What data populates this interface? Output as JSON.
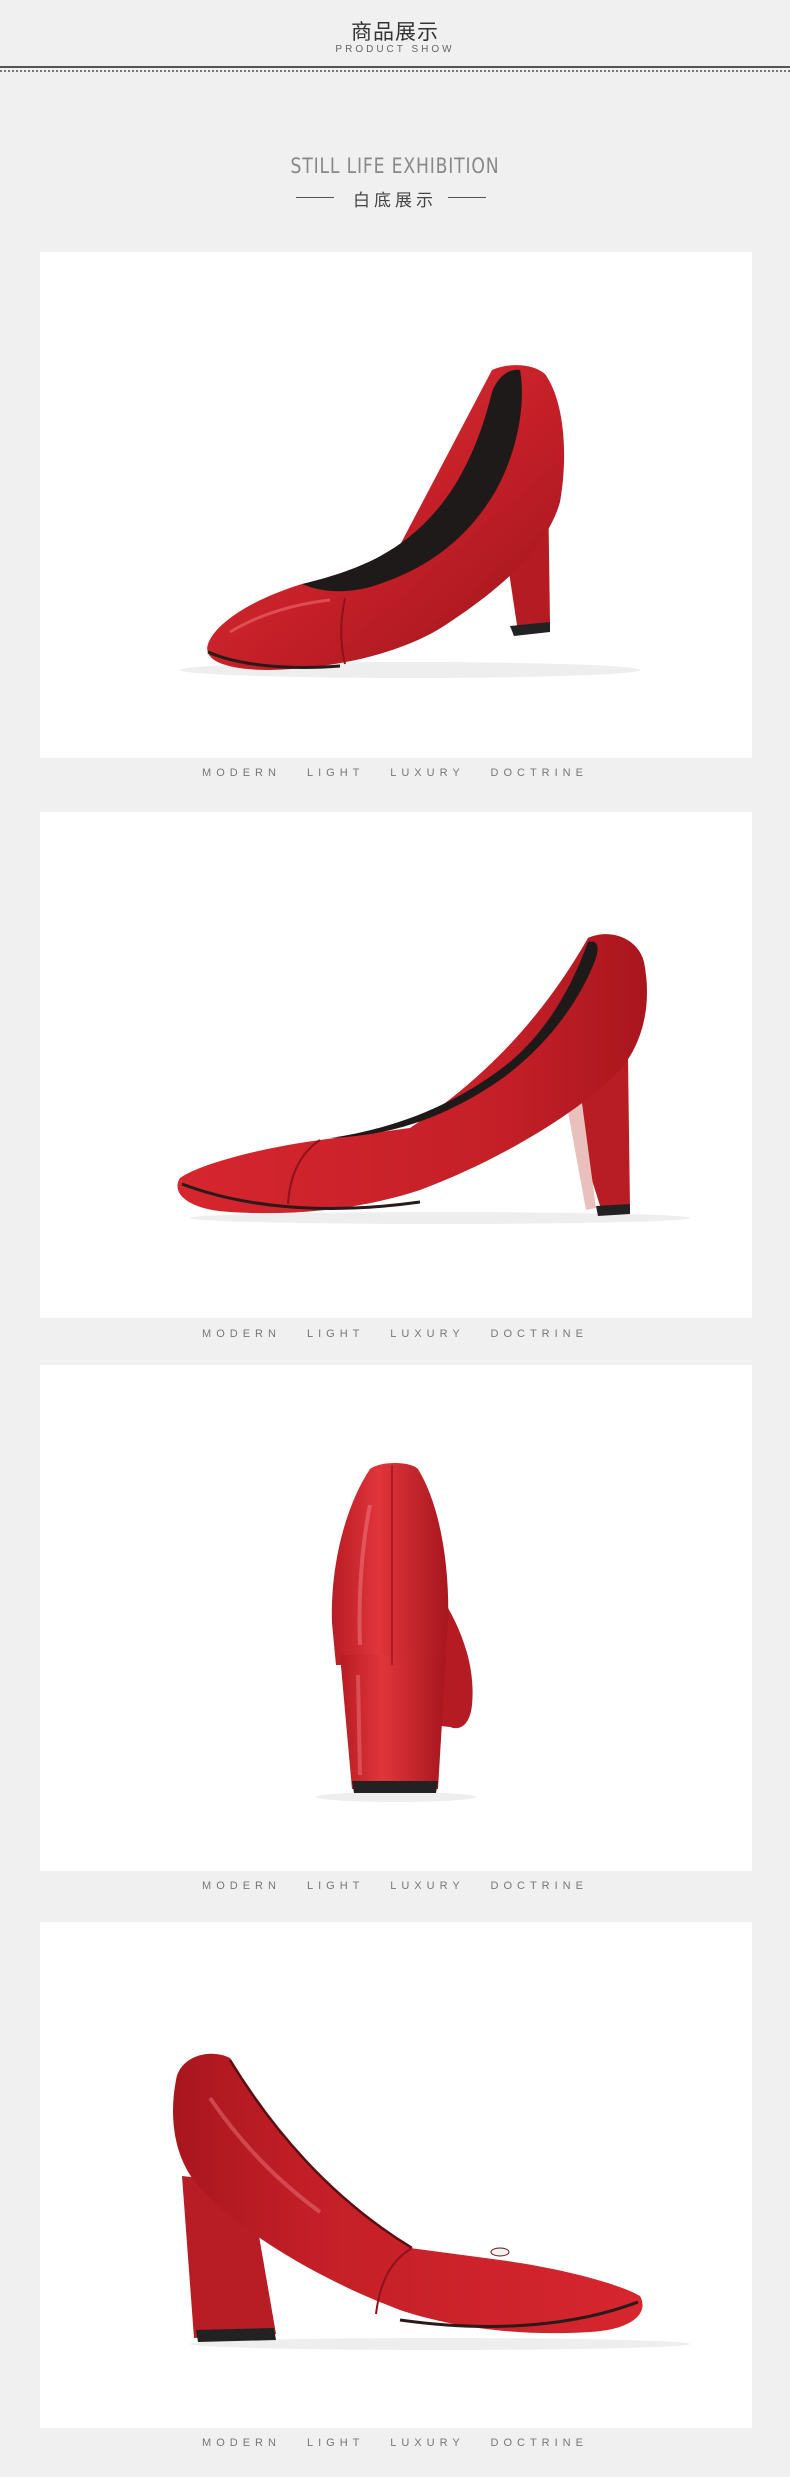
{
  "header": {
    "title_cn": "商品展示",
    "title_en": "PRODUCT SHOW"
  },
  "section": {
    "title_en": "STILL LIFE EXHIBITION",
    "title_cn": "白底展示"
  },
  "gallery": {
    "caption": "MODERN  LIGHT  LUXURY DOCTRINE",
    "items": [
      {
        "view": "three-quarter-front"
      },
      {
        "view": "side-profile-right"
      },
      {
        "view": "back-heel"
      },
      {
        "view": "side-profile-left"
      }
    ]
  },
  "colors": {
    "page_background": "#f0f0f0",
    "panel_background": "#ffffff",
    "shoe_red": "#c8202a",
    "shoe_lining": "#1f1a1a"
  }
}
